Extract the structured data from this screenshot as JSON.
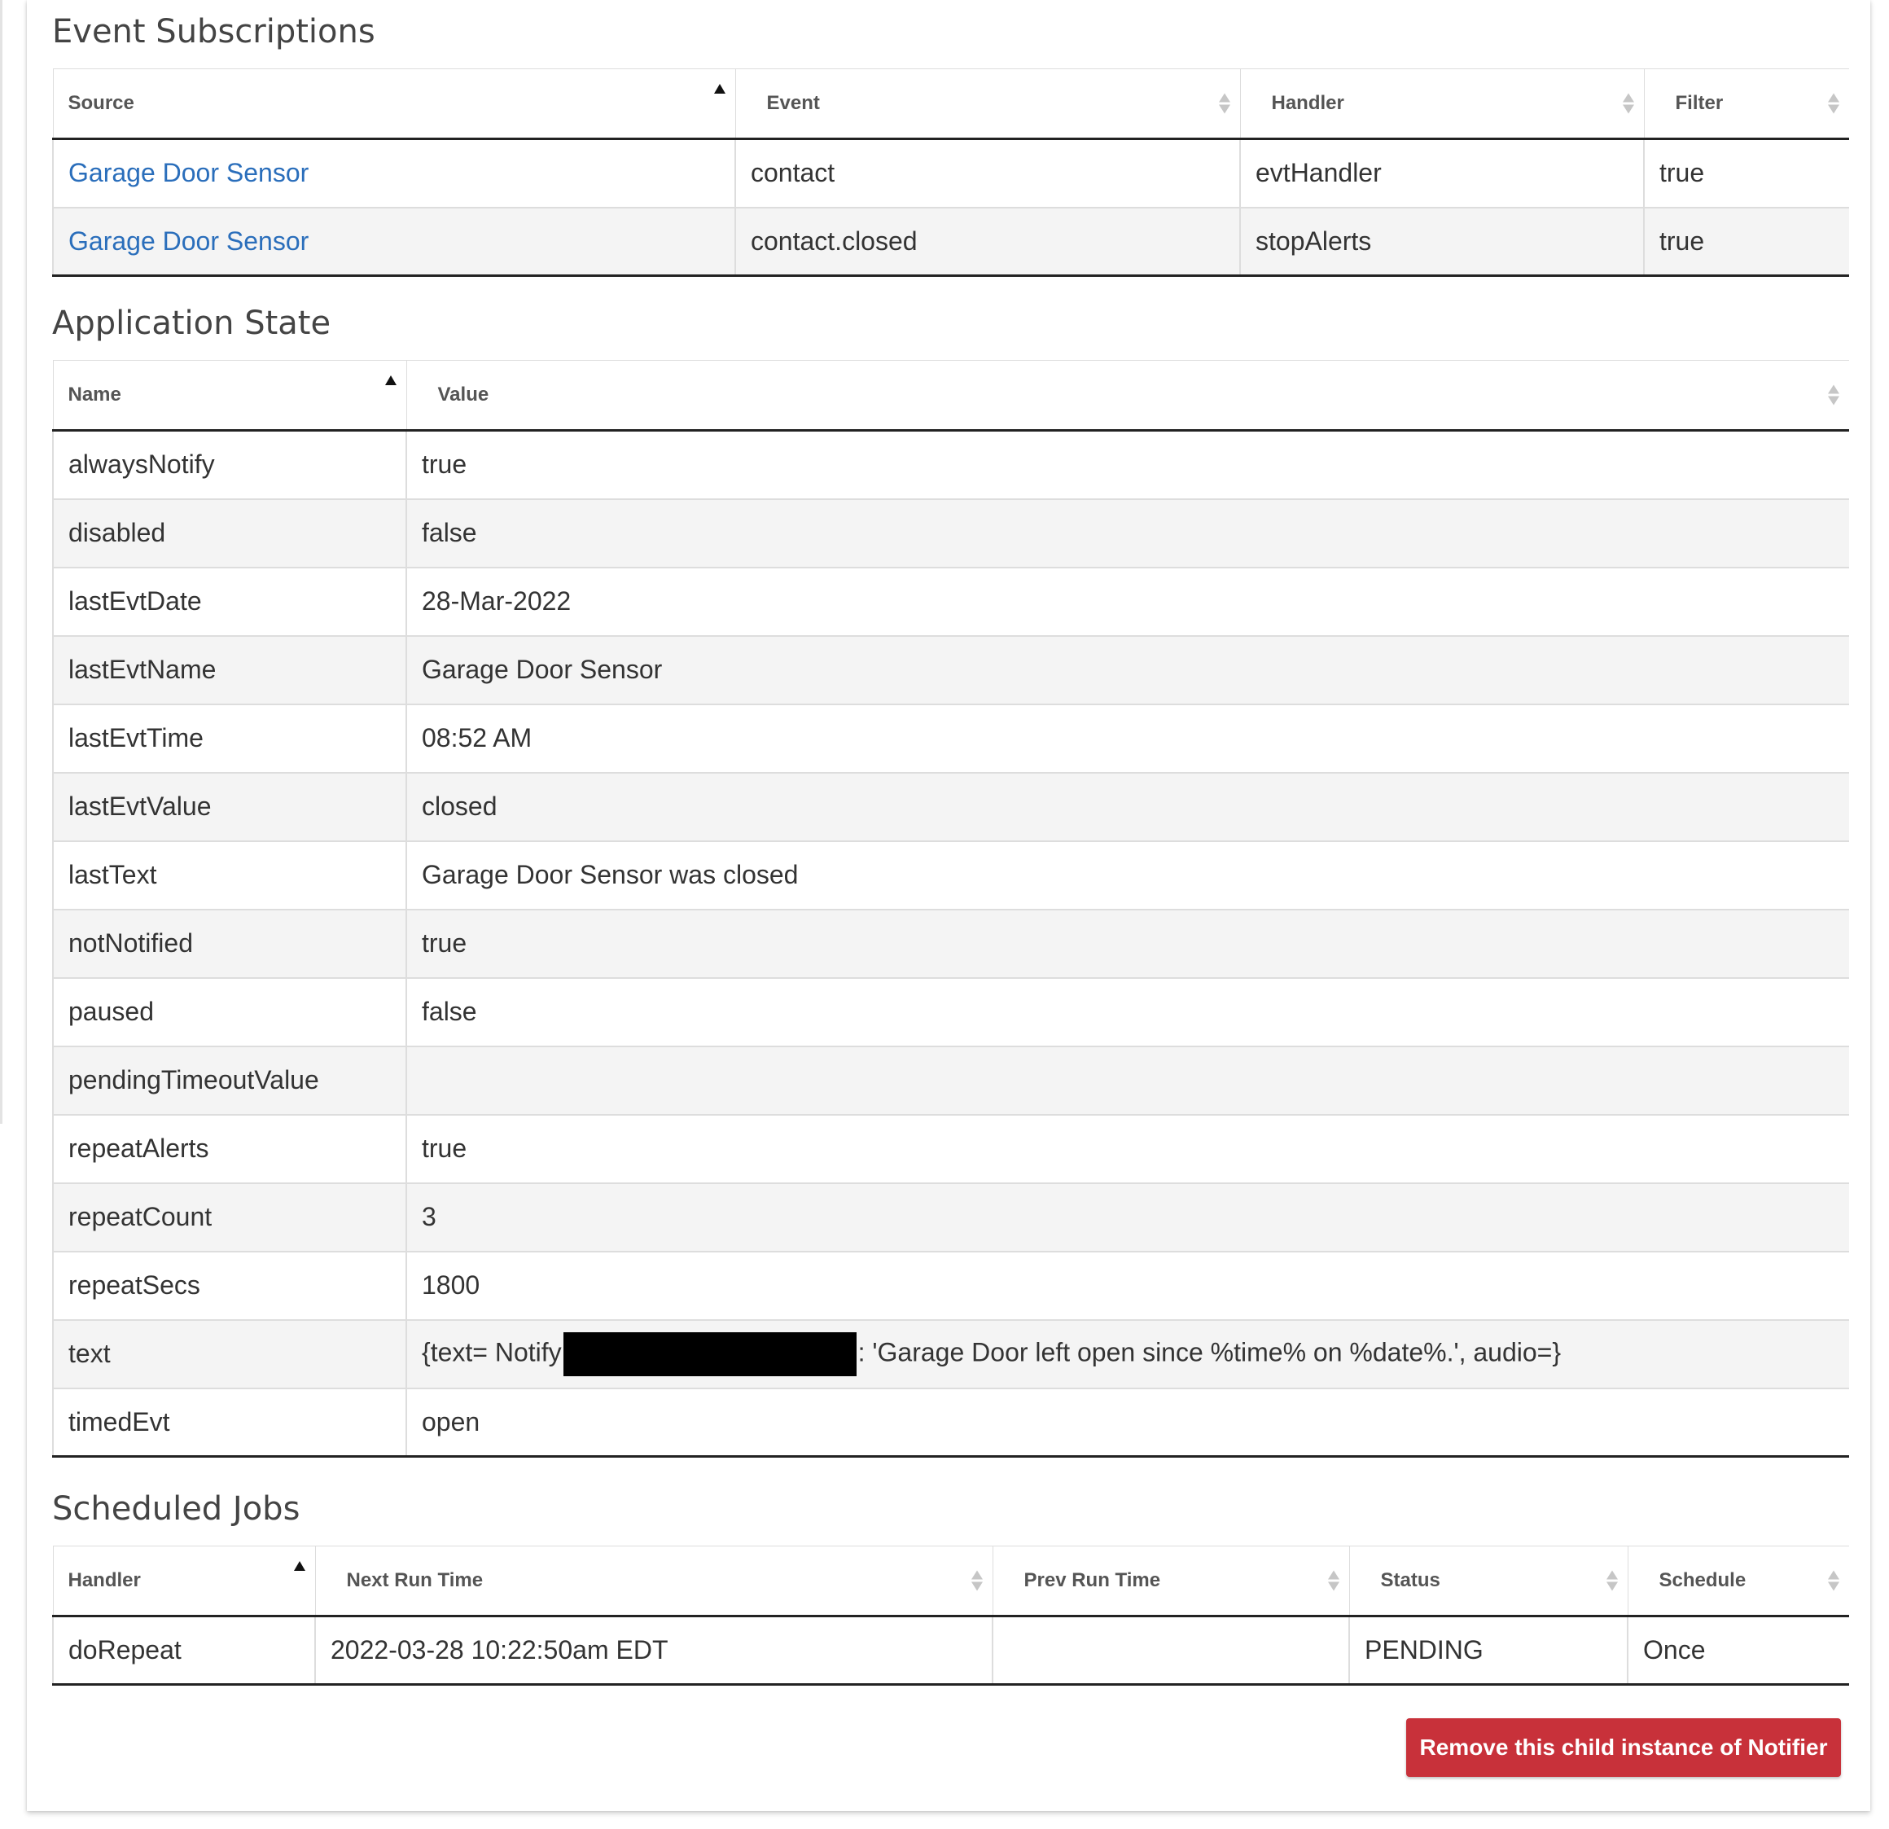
{
  "event_subscriptions": {
    "title": "Event Subscriptions",
    "columns": [
      "Source",
      "Event",
      "Handler",
      "Filter"
    ],
    "rows": [
      {
        "source": "Garage Door Sensor",
        "event": "contact",
        "handler": "evtHandler",
        "filter": "true"
      },
      {
        "source": "Garage Door Sensor",
        "event": "contact.closed",
        "handler": "stopAlerts",
        "filter": "true"
      }
    ]
  },
  "application_state": {
    "title": "Application State",
    "columns": [
      "Name",
      "Value"
    ],
    "rows": [
      {
        "name": "alwaysNotify",
        "value": "true"
      },
      {
        "name": "disabled",
        "value": "false"
      },
      {
        "name": "lastEvtDate",
        "value": "28-Mar-2022"
      },
      {
        "name": "lastEvtName",
        "value": "Garage Door Sensor"
      },
      {
        "name": "lastEvtTime",
        "value": "08:52 AM"
      },
      {
        "name": "lastEvtValue",
        "value": "closed"
      },
      {
        "name": "lastText",
        "value": "Garage Door Sensor was closed"
      },
      {
        "name": "notNotified",
        "value": "true"
      },
      {
        "name": "paused",
        "value": "false"
      },
      {
        "name": "pendingTimeoutValue",
        "value": ""
      },
      {
        "name": "repeatAlerts",
        "value": "true"
      },
      {
        "name": "repeatCount",
        "value": "3"
      },
      {
        "name": "repeatSecs",
        "value": "1800"
      },
      {
        "name": "text",
        "value_prefix": "{text= Notify",
        "value_suffix": ": 'Garage Door left open since %time% on %date%.', audio=}"
      },
      {
        "name": "timedEvt",
        "value": "open"
      }
    ]
  },
  "scheduled_jobs": {
    "title": "Scheduled Jobs",
    "columns": [
      "Handler",
      "Next Run Time",
      "Prev Run Time",
      "Status",
      "Schedule"
    ],
    "rows": [
      {
        "handler": "doRepeat",
        "next_run_time": "2022-03-28 10:22:50am EDT",
        "prev_run_time": "",
        "status": "PENDING",
        "schedule": "Once"
      }
    ]
  },
  "actions": {
    "remove_label": "Remove this child instance of Notifier"
  },
  "colors": {
    "link": "#2a6ebb",
    "danger_button": "#c8313a",
    "striped_row": "#f4f4f4"
  },
  "icons": {
    "sort_ascending": "triangle-up-icon",
    "sort_both": "sort-arrows-icon"
  }
}
